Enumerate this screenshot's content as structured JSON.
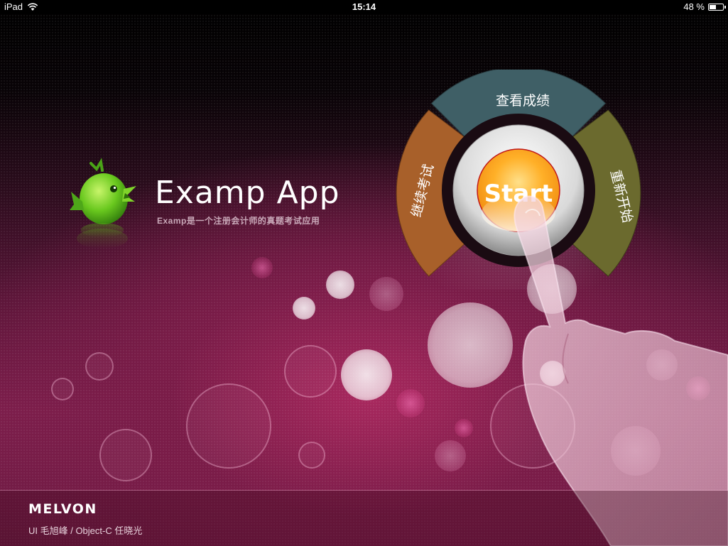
{
  "status_bar": {
    "device": "iPad",
    "time": "15:14",
    "battery": "48 %",
    "battery_level": 0.48,
    "icons": [
      "wifi-icon",
      "battery-icon"
    ]
  },
  "app": {
    "title": "Examp App",
    "subtitle": "Examp是一个注册会计师的真题考试应用",
    "logo_icon": "green-bird-icon"
  },
  "menu": {
    "top_label": "查看成绩",
    "left_label": "继续考试",
    "right_label": "重新开始",
    "start_label": "Start",
    "colors": {
      "top": "#3f5f66",
      "left": "#a8602a",
      "right": "#6b6a2e",
      "start": "#ffb23c"
    }
  },
  "footer": {
    "brand": "MELVON",
    "credits": "UI 毛旭峰 / Object-C 任晓光"
  }
}
